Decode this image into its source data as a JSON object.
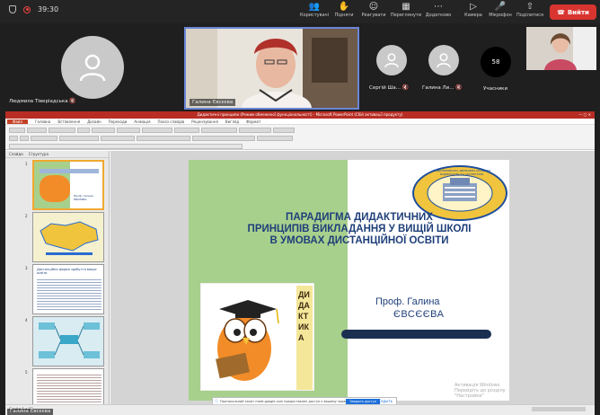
{
  "meeting": {
    "timer": "39:30",
    "leave_label": "Вийти",
    "toolbar": [
      {
        "label": "Користувачі",
        "icon": "users-icon"
      },
      {
        "label": "Підняти",
        "icon": "raise-hand-icon"
      },
      {
        "label": "Реагувати",
        "icon": "react-icon"
      },
      {
        "label": "Переглянути",
        "icon": "view-icon"
      },
      {
        "label": "Додатково",
        "icon": "more-icon"
      },
      {
        "label": "Камера",
        "icon": "camera-icon"
      },
      {
        "label": "Мікрофон",
        "icon": "microphone-icon"
      },
      {
        "label": "Поділитися",
        "icon": "share-icon"
      }
    ]
  },
  "participants": {
    "left_name": "Людмила Тіверіадська",
    "center_name": "Галина Євсєєва",
    "small1_name": "Сергій Ша...",
    "small2_name": "Галина Ли...",
    "others_count": "58",
    "others_label": "Учасники",
    "bottom_name": "Галина Євсєєва"
  },
  "powerpoint": {
    "title": "Дидактичні принципи (Режим обмеженої функціональності) - Microsoft PowerPoint (Сбій активації продукту)",
    "tabs": [
      "Файл",
      "Головна",
      "Вставлення",
      "Дизайн",
      "Переходи",
      "Анімація",
      "Показ слайдів",
      "Рецензування",
      "Вигляд",
      "Формат"
    ],
    "pane_tabs": [
      "Слайди",
      "Структура"
    ],
    "slide_numbers": [
      "1",
      "2",
      "3",
      "4",
      "5"
    ],
    "status": "Слайд 1 з 22"
  },
  "slide": {
    "title_line1": "ПАРАДИГМА ДИДАКТИЧНИХ",
    "title_line2": "ПРИНЦИПІВ ВИКЛАДАННЯ У ВИЩІЙ ШКОЛІ",
    "title_line3": "В УМОВАХ ДИСТАНЦІЙНОЇ ОСВІТИ",
    "author_prefix": "Проф. Галина",
    "author_surname": "ЄВСЄЄВА",
    "logo_text": "ПРИДНІПРОВСЬКА ДЕРЖАВНА АКАДЕМІЯ БУДІВНИЦТВА ТА АРХІТЕКТУРИ",
    "vertical_word": "ДИДАКТИКА",
    "watermark_line1": "Активація Windows",
    "watermark_line2": "Перейдіть до розділу \"Настройки\"",
    "thumb1_caption": "Проф. Галина ЄВСЄЄВА",
    "thumb3_title": "Дистанційна форма здобуття вищої освіти"
  },
  "browser_banner": {
    "text": "Протокольний запит meet.google.com предоставлен доступ к вашему экрану.",
    "allow": "Закрыть доступ",
    "hide": "Скрыть"
  },
  "colors": {
    "leave": "#d93530",
    "ppt_red": "#b72d24",
    "slide_green": "#a8d08d",
    "title_blue": "#1f3f7a"
  }
}
